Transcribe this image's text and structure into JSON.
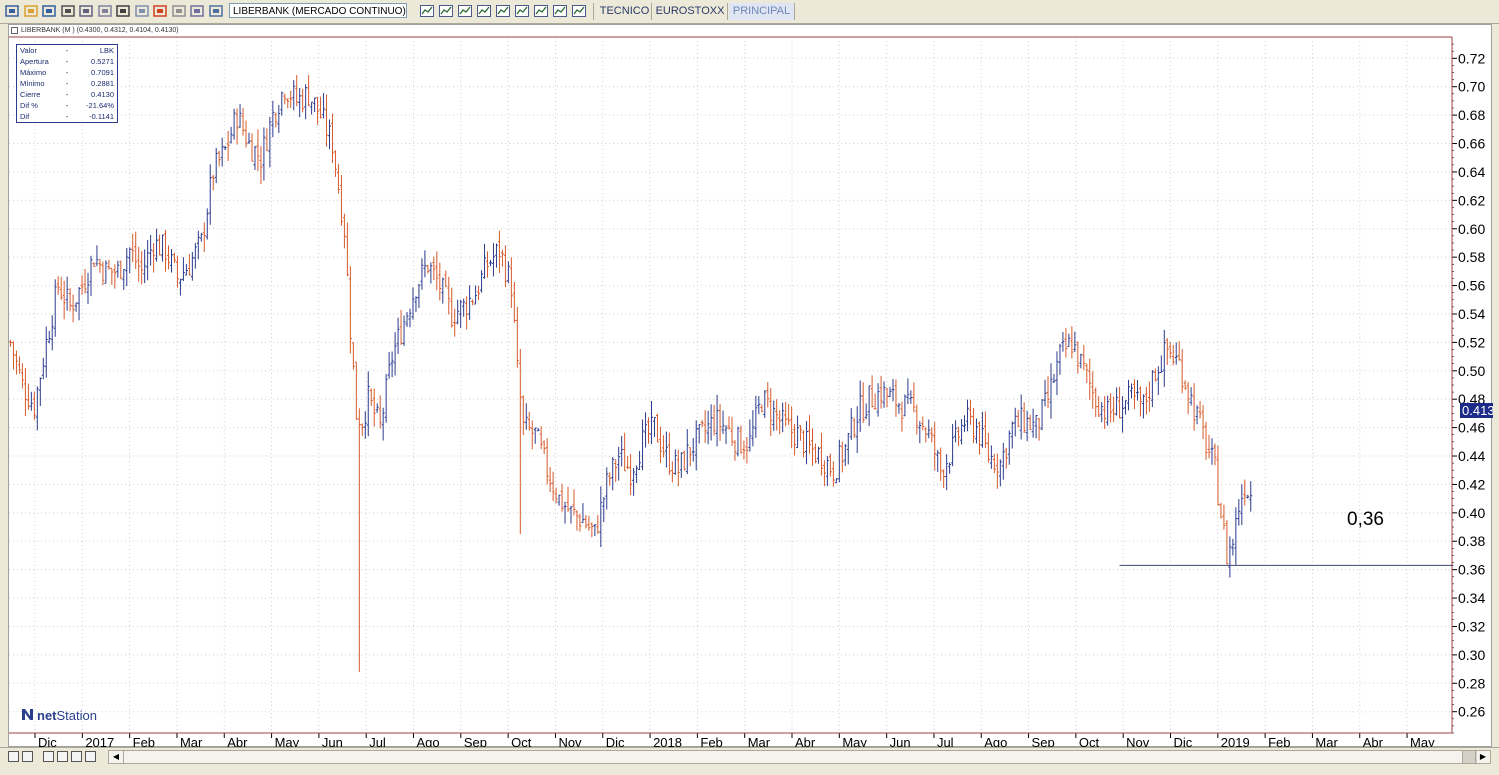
{
  "toolbar": {
    "symbol": "LIBERBANK (MERCADO CONTINUO)",
    "tabs": [
      {
        "label": "TECNICO",
        "active": false
      },
      {
        "label": "EUROSTOXX",
        "active": false
      },
      {
        "label": "PRINCIPAL",
        "active": true
      }
    ],
    "icons": [
      "new-icon",
      "open-icon",
      "save-icon",
      "print-icon",
      "print-preview-icon",
      "copy-icon",
      "cup-icon",
      "settings-icon",
      "pie-chart-icon",
      "text-icon",
      "properties-icon",
      "window-icon"
    ],
    "chart_icons": [
      "list-icon",
      "table-icon",
      "compare-icon",
      "indicator-icon",
      "bar-chart-icon",
      "line-chart-icon",
      "drawing-icon",
      "delete-drawing-icon",
      "grid-icon"
    ]
  },
  "chart": {
    "header": "LIBERBANK (M ) (0.4300, 0.4312, 0.4104, 0.4130)",
    "info": [
      {
        "key": "Valor",
        "value": "LBK"
      },
      {
        "key": "Apertura",
        "value": "0.5271"
      },
      {
        "key": "Máximo",
        "value": "0.7091"
      },
      {
        "key": "Mínimo",
        "value": "0.2881"
      },
      {
        "key": "Cierre",
        "value": "0.4130"
      },
      {
        "key": "Dif %",
        "value": "-21.64%"
      },
      {
        "key": "Dif",
        "value": "-0.1141"
      }
    ],
    "watermark": {
      "net": "net",
      "station": "Station"
    },
    "last_price": "0.413",
    "level_label": "0,36",
    "colors": {
      "up": "#2a3a8e",
      "down": "#d65a2a",
      "level": "#3a4a6a",
      "frame": "#a04040"
    }
  },
  "chart_data": {
    "type": "ohlc",
    "y_ticks": [
      "0.26",
      "0.28",
      "0.30",
      "0.32",
      "0.34",
      "0.36",
      "0.38",
      "0.40",
      "0.42",
      "0.44",
      "0.46",
      "0.48",
      "0.50",
      "0.52",
      "0.54",
      "0.56",
      "0.58",
      "0.60",
      "0.62",
      "0.64",
      "0.66",
      "0.68",
      "0.70",
      "0.72"
    ],
    "ylim": [
      0.245,
      0.735
    ],
    "x_labels": [
      "Dic",
      "2017",
      "Feb",
      "Mar",
      "Abr",
      "May",
      "Jun",
      "Jul",
      "Ago",
      "Sep",
      "Oct",
      "Nov",
      "Dic",
      "2018",
      "Feb",
      "Mar",
      "Abr",
      "May",
      "Jun",
      "Jul",
      "Ago",
      "Sep",
      "Oct",
      "Nov",
      "Dic",
      "2019",
      "Feb",
      "Mar",
      "Abr",
      "May"
    ],
    "x_label_index": [
      0,
      1,
      2,
      3,
      4,
      5,
      6,
      7,
      8,
      9,
      10,
      11,
      12,
      13,
      14,
      15,
      16,
      17,
      18,
      19,
      20,
      21,
      22,
      23,
      24,
      25,
      26,
      27,
      28,
      29
    ],
    "price_path": [
      [
        0,
        0.52
      ],
      [
        4,
        0.49
      ],
      [
        8,
        0.475
      ],
      [
        12,
        0.52
      ],
      [
        16,
        0.56
      ],
      [
        20,
        0.545
      ],
      [
        24,
        0.56
      ],
      [
        28,
        0.58
      ],
      [
        32,
        0.57
      ],
      [
        36,
        0.57
      ],
      [
        40,
        0.585
      ],
      [
        44,
        0.57
      ],
      [
        48,
        0.59
      ],
      [
        52,
        0.585
      ],
      [
        56,
        0.565
      ],
      [
        60,
        0.575
      ],
      [
        64,
        0.59
      ],
      [
        68,
        0.64
      ],
      [
        72,
        0.655
      ],
      [
        76,
        0.68
      ],
      [
        80,
        0.66
      ],
      [
        84,
        0.65
      ],
      [
        88,
        0.68
      ],
      [
        92,
        0.7
      ],
      [
        96,
        0.69
      ],
      [
        100,
        0.695
      ],
      [
        104,
        0.68
      ],
      [
        108,
        0.66
      ],
      [
        112,
        0.6
      ],
      [
        114,
        0.53
      ],
      [
        116,
        0.47
      ],
      [
        118,
        0.465
      ],
      [
        120,
        0.48
      ],
      [
        124,
        0.46
      ],
      [
        128,
        0.51
      ],
      [
        132,
        0.535
      ],
      [
        136,
        0.56
      ],
      [
        140,
        0.575
      ],
      [
        144,
        0.56
      ],
      [
        148,
        0.54
      ],
      [
        152,
        0.545
      ],
      [
        156,
        0.555
      ],
      [
        160,
        0.575
      ],
      [
        164,
        0.585
      ],
      [
        168,
        0.56
      ],
      [
        170,
        0.5
      ],
      [
        172,
        0.46
      ],
      [
        176,
        0.455
      ],
      [
        180,
        0.43
      ],
      [
        184,
        0.41
      ],
      [
        188,
        0.4
      ],
      [
        192,
        0.395
      ],
      [
        196,
        0.385
      ],
      [
        200,
        0.42
      ],
      [
        204,
        0.44
      ],
      [
        208,
        0.43
      ],
      [
        212,
        0.45
      ],
      [
        216,
        0.46
      ],
      [
        220,
        0.44
      ],
      [
        224,
        0.43
      ],
      [
        228,
        0.445
      ],
      [
        232,
        0.455
      ],
      [
        236,
        0.465
      ],
      [
        240,
        0.46
      ],
      [
        244,
        0.45
      ],
      [
        248,
        0.45
      ],
      [
        252,
        0.48
      ],
      [
        256,
        0.47
      ],
      [
        260,
        0.46
      ],
      [
        264,
        0.455
      ],
      [
        268,
        0.445
      ],
      [
        272,
        0.44
      ],
      [
        276,
        0.43
      ],
      [
        280,
        0.445
      ],
      [
        284,
        0.47
      ],
      [
        288,
        0.48
      ],
      [
        292,
        0.485
      ],
      [
        296,
        0.48
      ],
      [
        300,
        0.475
      ],
      [
        304,
        0.47
      ],
      [
        308,
        0.455
      ],
      [
        312,
        0.43
      ],
      [
        316,
        0.445
      ],
      [
        320,
        0.465
      ],
      [
        324,
        0.46
      ],
      [
        328,
        0.44
      ],
      [
        332,
        0.435
      ],
      [
        336,
        0.46
      ],
      [
        340,
        0.465
      ],
      [
        344,
        0.46
      ],
      [
        348,
        0.48
      ],
      [
        352,
        0.51
      ],
      [
        356,
        0.52
      ],
      [
        360,
        0.5
      ],
      [
        364,
        0.48
      ],
      [
        368,
        0.47
      ],
      [
        372,
        0.475
      ],
      [
        376,
        0.48
      ],
      [
        380,
        0.475
      ],
      [
        384,
        0.5
      ],
      [
        388,
        0.515
      ],
      [
        392,
        0.505
      ],
      [
        396,
        0.48
      ],
      [
        400,
        0.455
      ],
      [
        404,
        0.43
      ],
      [
        406,
        0.4
      ],
      [
        408,
        0.37
      ],
      [
        410,
        0.38
      ],
      [
        412,
        0.405
      ],
      [
        414,
        0.42
      ],
      [
        416,
        0.413
      ]
    ],
    "spikes": [
      {
        "i": 117,
        "low": 0.288
      },
      {
        "i": 171,
        "low": 0.385
      }
    ],
    "level": {
      "value": 0.363,
      "x_start": 372,
      "x_end": 484
    }
  }
}
